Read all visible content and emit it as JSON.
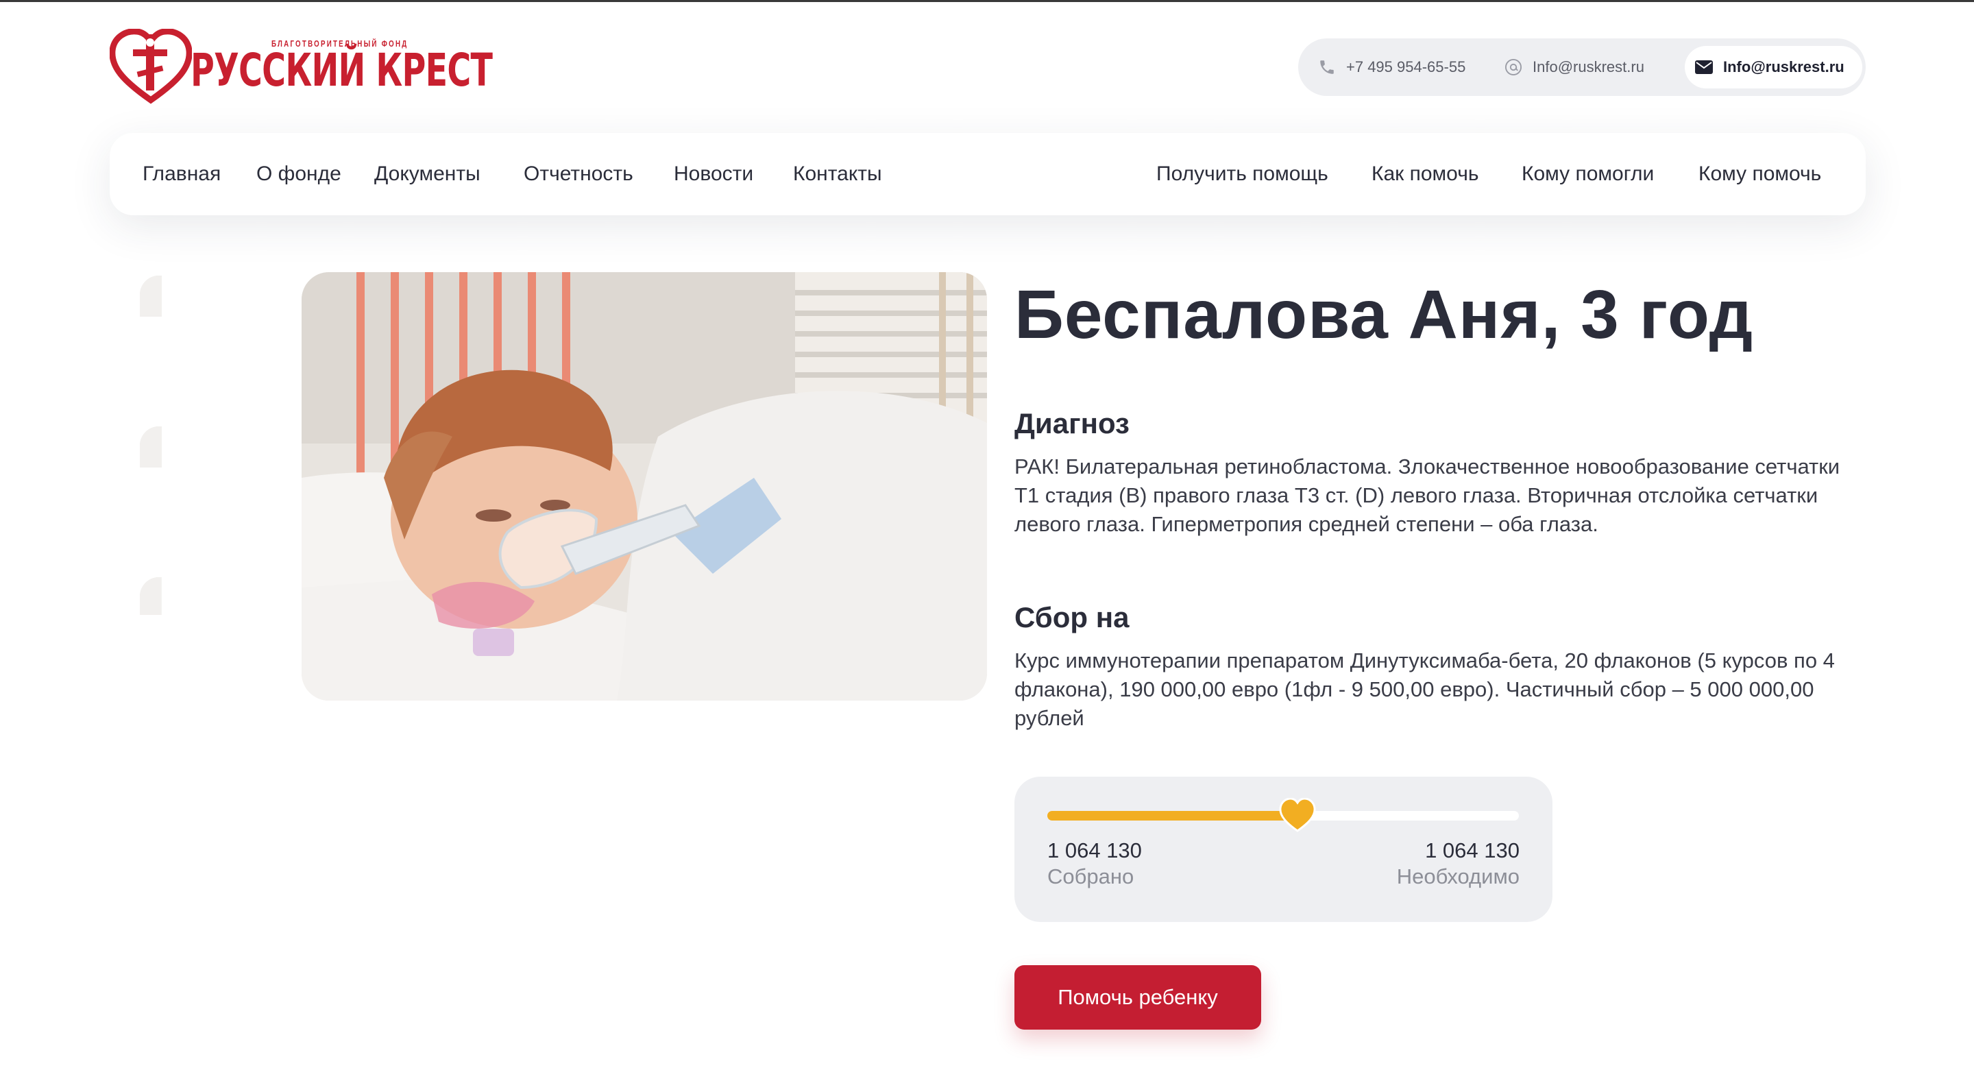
{
  "brand": {
    "subtitle": "БЛАГОТВОРИТЕЛЬНЫЙ ФОНД",
    "name": "РУССКИЙ КРЕСТ",
    "color": "#c8202f"
  },
  "contacts": {
    "phone": "+7 495 954-65-55",
    "email_plain": "Info@ruskrest.ru",
    "email_highlight": "Info@ruskrest.ru"
  },
  "nav": {
    "left": [
      "Главная",
      "О фонде",
      "Документы",
      "Отчетность",
      "Новости",
      "Контакты"
    ],
    "right": [
      "Получить помощь",
      "Как помочь",
      "Кому помогли",
      "Кому помочь"
    ]
  },
  "child": {
    "title": "Беспалова Аня, 3 год",
    "diagnosis_heading": "Диагноз",
    "diagnosis_text": "РАК! Билатеральная ретинобластома. Злокачественное новообразование сетчатки Т1 стадия (В) правого глаза Т3 ст. (D) левого глаза. Вторичная отслойка сетчатки левого глаза. Гиперметропия средней степени – оба глаза.",
    "fundraise_heading": "Сбор на",
    "fundraise_text": "Курс иммунотерапии препаратом Динутуксимаба-бета, 20 флаконов (5 курсов по 4 флакона), 190 000,00 евро (1фл - 9 500,00 евро). Частичный сбор – 5 000 000,00 рублей"
  },
  "progress": {
    "collected_amount": "1 064 130",
    "collected_label": "Собрано",
    "required_amount": "1 064 130",
    "required_label": "Необходимо",
    "fraction": 0.53,
    "bar_color": "#f2ae22"
  },
  "cta": {
    "label": "Помочь ребенку",
    "color": "#c41e32"
  },
  "gallery": {
    "thumbnails": 3
  }
}
